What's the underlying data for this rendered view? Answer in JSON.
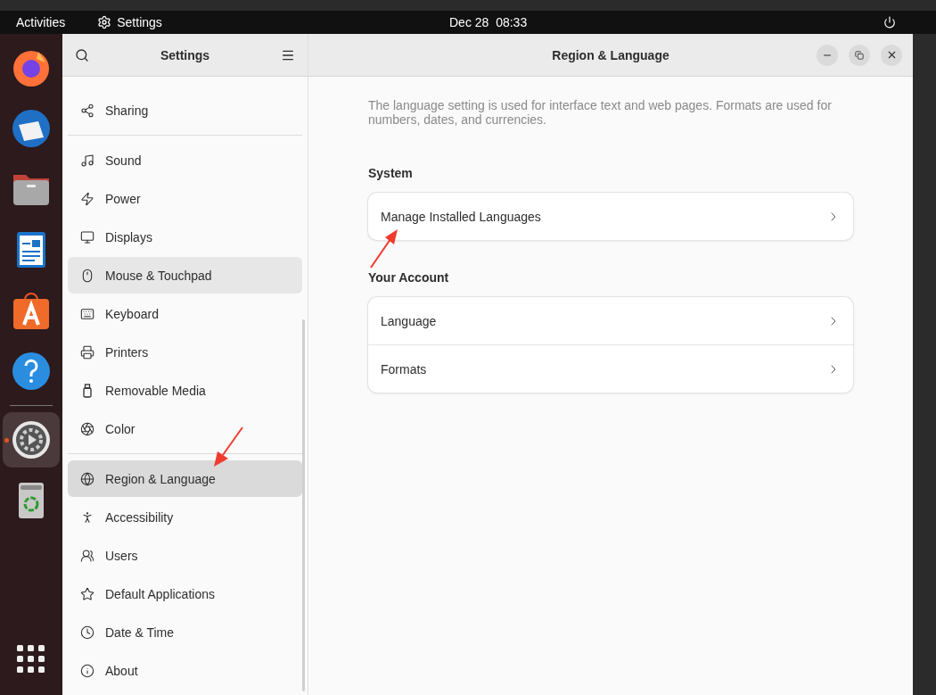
{
  "top_bar": {
    "activities": "Activities",
    "app_name": "Settings",
    "clock": "Dec 28  08:33"
  },
  "dock": {
    "apps": [
      {
        "selected": false,
        "running": false
      },
      {
        "selected": false,
        "running": false
      },
      {
        "selected": false,
        "running": false
      },
      {
        "selected": false,
        "running": false
      },
      {
        "selected": false,
        "running": false
      },
      {
        "selected": false,
        "running": false
      },
      {
        "selected": true,
        "running": true
      },
      {
        "selected": false,
        "running": false
      }
    ]
  },
  "sidebar": {
    "title": "Settings",
    "groups": [
      {
        "items": [
          {
            "label": "Sharing",
            "selected": false,
            "hovered": false
          }
        ]
      },
      {
        "items": [
          {
            "label": "Sound",
            "selected": false,
            "hovered": false
          },
          {
            "label": "Power",
            "selected": false,
            "hovered": false
          },
          {
            "label": "Displays",
            "selected": false,
            "hovered": false
          },
          {
            "label": "Mouse & Touchpad",
            "selected": false,
            "hovered": true
          },
          {
            "label": "Keyboard",
            "selected": false,
            "hovered": false
          },
          {
            "label": "Printers",
            "selected": false,
            "hovered": false
          },
          {
            "label": "Removable Media",
            "selected": false,
            "hovered": false
          },
          {
            "label": "Color",
            "selected": false,
            "hovered": false
          }
        ]
      },
      {
        "items": [
          {
            "label": "Region & Language",
            "selected": true,
            "hovered": false
          },
          {
            "label": "Accessibility",
            "selected": false,
            "hovered": false
          },
          {
            "label": "Users",
            "selected": false,
            "hovered": false
          },
          {
            "label": "Default Applications",
            "selected": false,
            "hovered": false
          },
          {
            "label": "Date & Time",
            "selected": false,
            "hovered": false
          },
          {
            "label": "About",
            "selected": false,
            "hovered": false
          }
        ]
      }
    ]
  },
  "window": {
    "title": "Region & Language"
  },
  "content": {
    "description": "The language setting is used for interface text and web pages. Formats are used for numbers, dates, and currencies.",
    "sections": [
      {
        "heading": "System",
        "rows": [
          {
            "label": "Manage Installed Languages"
          }
        ]
      },
      {
        "heading": "Your Account",
        "rows": [
          {
            "label": "Language"
          },
          {
            "label": "Formats"
          }
        ]
      }
    ]
  }
}
